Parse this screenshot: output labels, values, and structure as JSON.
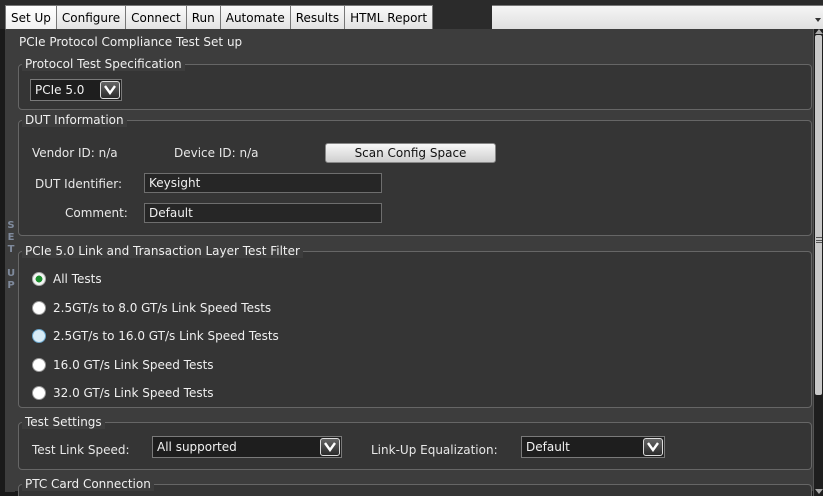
{
  "tabs": [
    "Set Up",
    "Configure",
    "Connect",
    "Run",
    "Automate",
    "Results",
    "HTML Report"
  ],
  "active_tab": "Set Up",
  "side_label": [
    "S",
    "E",
    "T",
    "",
    "U",
    "P"
  ],
  "page_title": "PCIe Protocol Compliance Test Set up",
  "spec": {
    "title": "Protocol Test Specification",
    "selected": "PCIe 5.0"
  },
  "dut": {
    "title": "DUT Information",
    "vendor_id": "Vendor ID: n/a",
    "device_id": "Device ID: n/a",
    "scan_button": "Scan Config Space",
    "identifier_label": "DUT Identifier:",
    "identifier_value": "Keysight",
    "comment_label": "Comment:",
    "comment_value": "Default"
  },
  "filter": {
    "title": "PCIe 5.0 Link and Transaction Layer Test Filter",
    "options": [
      "All Tests",
      "2.5GT/s to 8.0 GT/s Link Speed Tests",
      "2.5GT/s to 16.0 GT/s Link Speed Tests",
      "16.0 GT/s Link Speed Tests",
      "32.0 GT/s Link Speed Tests"
    ],
    "selected_index": 0
  },
  "settings": {
    "title": "Test Settings",
    "link_speed_label": "Test Link Speed:",
    "link_speed_value": "All supported",
    "equalization_label": "Link-Up Equalization:",
    "equalization_value": "Default"
  },
  "ptc": {
    "title": "PTC Card Connection"
  },
  "colors": {
    "panel": "#3d3d3d",
    "selected_radio": "#1c8d2e"
  }
}
